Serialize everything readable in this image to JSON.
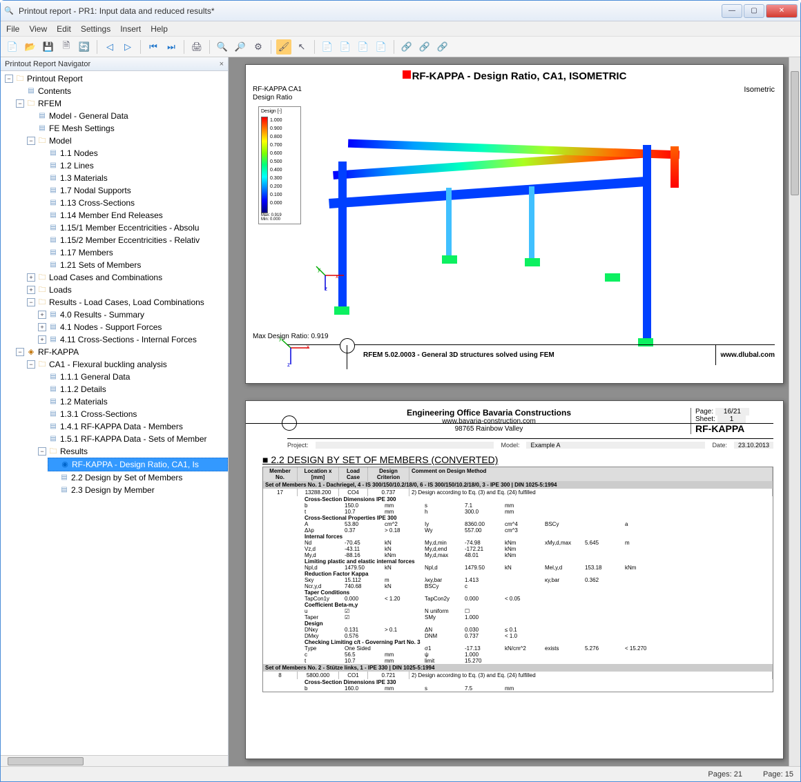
{
  "window": {
    "title": "Printout report - PR1: Input data and reduced results*"
  },
  "menu": [
    "File",
    "View",
    "Edit",
    "Settings",
    "Insert",
    "Help"
  ],
  "nav": {
    "title": "Printout Report Navigator",
    "tree": {
      "root": "Printout Report",
      "contents": "Contents",
      "rfem": "RFEM",
      "rfem_items": {
        "model_general": "Model - General Data",
        "fe_mesh": "FE Mesh Settings",
        "model": "Model",
        "model_sub": [
          "1.1 Nodes",
          "1.2 Lines",
          "1.3 Materials",
          "1.7 Nodal Supports",
          "1.13 Cross-Sections",
          "1.14 Member End Releases",
          "1.15/1 Member Eccentricities - Absolu",
          "1.15/2 Member Eccentricities - Relativ",
          "1.17 Members",
          "1.21 Sets of Members"
        ],
        "lc": "Load Cases and Combinations",
        "loads": "Loads",
        "results": "Results - Load Cases, Load Combinations",
        "results_sub": [
          "4.0 Results - Summary",
          "4.1 Nodes - Support Forces",
          "4.11 Cross-Sections - Internal Forces"
        ]
      },
      "rfkappa": "RF-KAPPA",
      "ca1": "CA1 - Flexural buckling analysis",
      "ca1_sub": [
        "1.1.1 General Data",
        "1.1.2 Details",
        "1.2 Materials",
        "1.3.1 Cross-Sections",
        "1.4.1 RF-KAPPA Data - Members",
        "1.5.1 RF-KAPPA Data - Sets of Member"
      ],
      "results2": "Results",
      "results2_sub": {
        "sel": "RF-KAPPA -  Design Ratio, CA1, Is",
        "r2": "2.2 Design by Set of Members",
        "r3": "2.3 Design by Member"
      }
    }
  },
  "page1": {
    "title": "RF-KAPPA -  Design Ratio, CA1, ISOMETRIC",
    "iso": "Isometric",
    "chartlbl1": "RF-KAPPA CA1",
    "chartlbl2": "Design Ratio",
    "legend_title": "Design [-]",
    "legend_vals": [
      "1.000",
      "0.900",
      "0.800",
      "0.700",
      "0.600",
      "0.500",
      "0.400",
      "0.300",
      "0.200",
      "0.100",
      "0.000"
    ],
    "legend_maxmin": [
      "Max: 0.919",
      "Min: 0.000"
    ],
    "max": "Max Design Ratio: 0.919",
    "foot": "RFEM 5.02.0003 - General 3D structures solved using FEM",
    "dlubal": "www.dlubal.com"
  },
  "page2": {
    "company": "Engineering Office Bavaria Constructions",
    "url": "www.bavaria-construction.com",
    "addr": "98765 Rainbow Valley",
    "page": "16/21",
    "sheet": "1",
    "module": "RF-KAPPA",
    "project_label": "Project:",
    "model_label": "Model:",
    "model_val": "Example A",
    "date_label": "Date:",
    "date_val": "23.10.2013",
    "section": "2.2 DESIGN BY SET OF MEMBERS (CONVERTED)",
    "cols": [
      "Member No.",
      "Location x [mm]",
      "Load Case",
      "Design Criterion",
      "Comment on Design Method"
    ],
    "set1": "Set of Members No. 1 - Dachriegel, 4 - IS 300/150/10.2/18/0, 6 - IS 300/150/10.2/18/0, 3 - IPE 300 | DIN 1025-5:1994",
    "row1": {
      "m": "17",
      "x": "13288.200",
      "lc": "CO4",
      "dc": "0.737",
      "cm": "2) Design according to Eq. (3) and Eq. (24) fulfilled"
    },
    "cs_dim_h": "Cross-Section Dimensions IPE 300",
    "cs_dim": [
      [
        "b",
        "150.0",
        "mm",
        "s",
        "7.1",
        "mm"
      ],
      [
        "t",
        "10.7",
        "mm",
        "h",
        "300.0",
        "mm"
      ]
    ],
    "cs_prop_h": "Cross-Sectional Properties IPE 300",
    "cs_prop": [
      [
        "A",
        "53.80",
        "cm^2",
        "Iy",
        "8360.00",
        "cm^4",
        "BSCy",
        "",
        "a"
      ],
      [
        "Δλp",
        "0.37",
        "> 0.18",
        "Wy",
        "557.00",
        "cm^3"
      ]
    ],
    "if_h": "Internal forces",
    "if": [
      [
        "Nd",
        "-70.45",
        "kN",
        "My,d,min",
        "-74.98",
        "kNm",
        "xMy,d,max",
        "5.645",
        "m"
      ],
      [
        "Vz,d",
        "-43.11",
        "kN",
        "My,d,end",
        "-172.21",
        "kNm"
      ],
      [
        "My,d",
        "-88.16",
        "kNm",
        "My,d,max",
        "48.01",
        "kNm"
      ]
    ],
    "lim_h": "Limiting plastic and elastic internal forces",
    "lim": [
      [
        "Npl,d",
        "1479.50",
        "kN",
        "Npl,d",
        "1479.50",
        "kN",
        "Mel,y,d",
        "153.18",
        "kNm"
      ]
    ],
    "red_h": "Reduction Factor Kappa",
    "red": [
      [
        "Sκy",
        "15.112",
        "m",
        "λκy,bar",
        "1.413",
        "",
        "κy,bar",
        "0.362"
      ],
      [
        "Ncr,y,d",
        "740.68",
        "kN",
        "BSCy",
        "c"
      ]
    ],
    "tap_h": "Taper Conditions",
    "tap": [
      [
        "TapCon1y",
        "0.000",
        "< 1.20",
        "TapCon2y",
        "0.000",
        "< 0.05"
      ]
    ],
    "coef_h": "Coefficient Beta-m,y",
    "coef": [
      [
        "u",
        "☑",
        "",
        "N uniform",
        "☐"
      ],
      [
        "Taper",
        "☑",
        "",
        "SMy",
        "1.000"
      ]
    ],
    "des_h": "Design",
    "des": [
      [
        "DNκy",
        "0.131",
        "> 0.1",
        "ΔN",
        "0.030",
        "≤ 0.1"
      ],
      [
        "DMκy",
        "0.576",
        "",
        "DNM",
        "0.737",
        "< 1.0"
      ]
    ],
    "chk_h": "Checking Limiting c/t - Governing Part No. 3",
    "chk": [
      [
        "Type",
        "One Sided",
        "",
        "σ1",
        "-17.13",
        "kN/cm^2",
        "exists",
        "5.276",
        "< 15.270"
      ],
      [
        "c",
        "56.5",
        "mm",
        "ψ",
        "1.000"
      ],
      [
        "t",
        "10.7",
        "mm",
        "limit",
        "15.270"
      ]
    ],
    "set2": "Set of Members No. 2 - Stütze links, 1 - IPE 330 | DIN 1025-5:1994",
    "row2": {
      "m": "8",
      "x": "5800.000",
      "lc": "CO1",
      "dc": "0.721",
      "cm": "2) Design according to Eq. (3) and Eq. (24) fulfilled"
    },
    "cs_dim2_h": "Cross-Section Dimensions IPE 330",
    "cs_dim2": [
      [
        "b",
        "160.0",
        "mm",
        "s",
        "7.5",
        "mm"
      ]
    ]
  },
  "status": {
    "pages": "Pages: 21",
    "page": "Page: 15"
  },
  "chart_data": {
    "type": "bar",
    "title": "Design Ratio Legend",
    "categories": [
      "1.000",
      "0.900",
      "0.800",
      "0.700",
      "0.600",
      "0.500",
      "0.400",
      "0.300",
      "0.200",
      "0.100",
      "0.000"
    ],
    "values": [
      1.0,
      0.9,
      0.8,
      0.7,
      0.6,
      0.5,
      0.4,
      0.3,
      0.2,
      0.1,
      0.0
    ],
    "ylim": [
      0,
      1
    ],
    "note": "Max Design Ratio: 0.919"
  }
}
